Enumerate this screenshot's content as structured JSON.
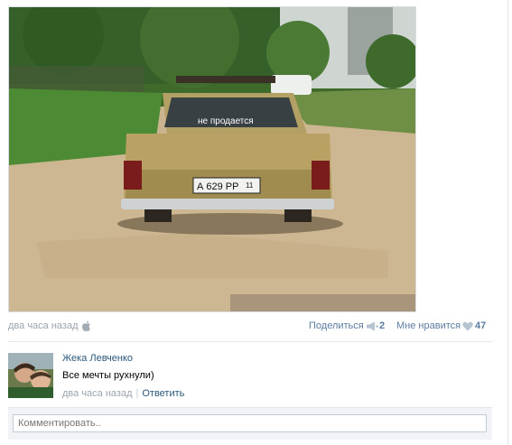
{
  "post": {
    "photo_plate": "А 629 РР",
    "photo_region": "11",
    "photo_window_sticker": "не продается",
    "time": "два часа назад",
    "platform_icon": "apple-icon",
    "share_label": "Поделиться",
    "share_count": "2",
    "like_label": "Мне нравится",
    "like_count": "47"
  },
  "comment": {
    "author": "Жека Левченко",
    "text": "Все мечты рухнули)",
    "time": "два часа назад",
    "reply_label": "Ответить"
  },
  "reply_box": {
    "placeholder": "Комментировать.."
  }
}
